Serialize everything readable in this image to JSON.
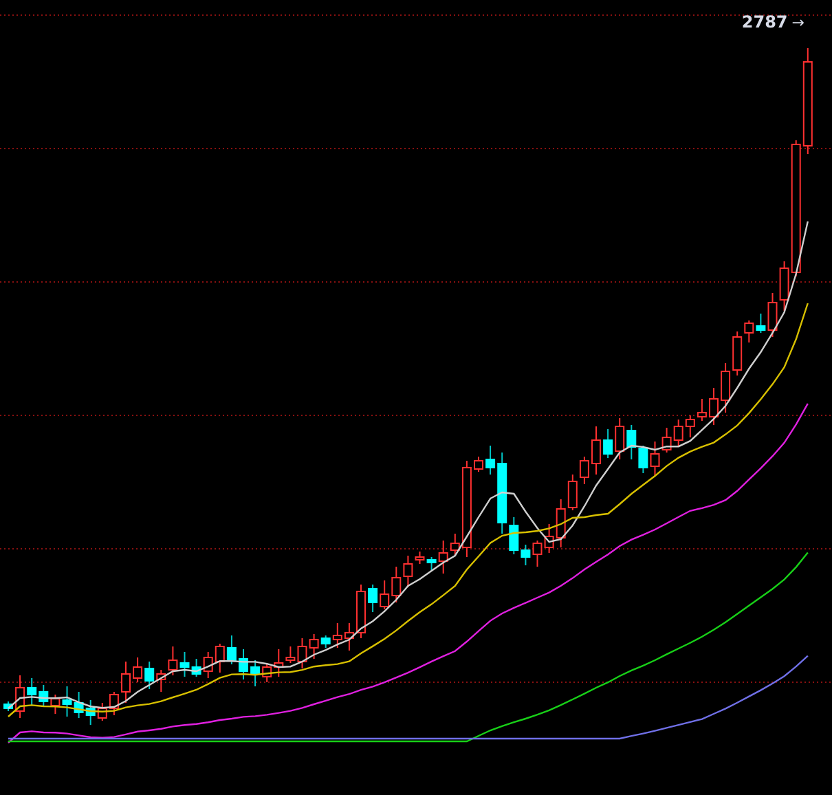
{
  "chart": {
    "high_label": {
      "value": "2787",
      "arrow": "→"
    }
  }
}
